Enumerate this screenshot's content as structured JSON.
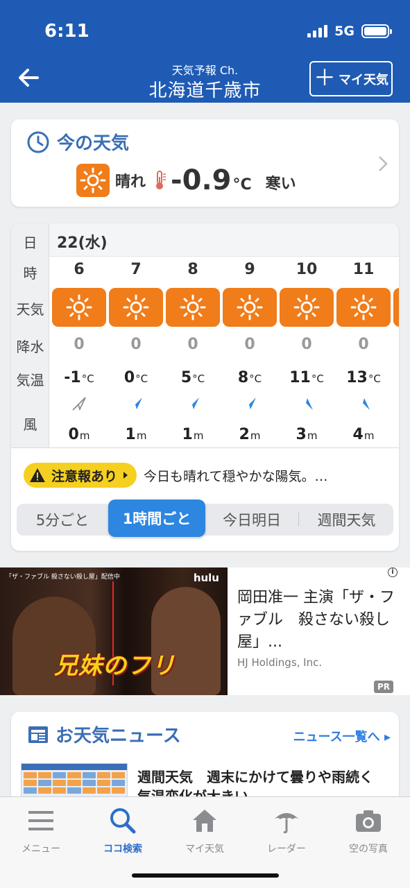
{
  "status_bar": {
    "time": "6:11",
    "network": "5G"
  },
  "header": {
    "subtitle": "天気予報 Ch.",
    "title": "北海道千歳市",
    "my_weather_label": "マイ天気",
    "color": "#1f5bb4"
  },
  "now": {
    "title": "今の天気",
    "weather": "晴れ",
    "temp": "-0.9",
    "unit": "°C",
    "feel": "寒い",
    "icon": "sun-icon"
  },
  "hourly": {
    "labels": {
      "day": "日",
      "hour": "時",
      "weather": "天気",
      "precip": "降水",
      "temp": "気温",
      "wind": "風"
    },
    "date": "22(水)",
    "hours": [
      {
        "hour": "6",
        "precip": "0",
        "temp": "-1",
        "wind": "0",
        "dir": "calm"
      },
      {
        "hour": "7",
        "precip": "0",
        "temp": "0",
        "wind": "1",
        "dir": "NE"
      },
      {
        "hour": "8",
        "precip": "0",
        "temp": "5",
        "wind": "1",
        "dir": "NE"
      },
      {
        "hour": "9",
        "precip": "0",
        "temp": "8",
        "wind": "2",
        "dir": "NE"
      },
      {
        "hour": "10",
        "precip": "0",
        "temp": "11",
        "wind": "3",
        "dir": "SE"
      },
      {
        "hour": "11",
        "precip": "0",
        "temp": "13",
        "wind": "4",
        "dir": "SE"
      }
    ],
    "temp_unit": "°C",
    "wind_unit": "m",
    "alert_label": "注意報あり",
    "alert_text": "今日も晴れて穏やかな陽気。…",
    "tabs": [
      "5分ごと",
      "1時間ごと",
      "今日明日",
      "週間天気"
    ],
    "active_tab": "1時間ごと"
  },
  "ad": {
    "caption": "「ザ・ファブル 殺さない殺し屋」配信中",
    "brand": "hulu",
    "promo": "兄妹のフリ",
    "title": "岡田准一 主演「ザ・ファブル　殺さない殺し屋」...",
    "sponsor": "HJ Holdings, Inc.",
    "pr": "PR",
    "info": "i"
  },
  "news": {
    "title": "お天気ニュース",
    "link": "ニュース一覧へ",
    "headline": "週間天気　週末にかけて曇りや雨続く　気温変化が大きい"
  },
  "tabbar": {
    "items": [
      {
        "label": "メニュー",
        "icon": "menu-icon"
      },
      {
        "label": "ココ検索",
        "icon": "search-icon"
      },
      {
        "label": "マイ天気",
        "icon": "home-icon"
      },
      {
        "label": "レーダー",
        "icon": "umbrella-icon"
      },
      {
        "label": "空の写真",
        "icon": "camera-icon"
      }
    ],
    "active": "ココ検索"
  }
}
